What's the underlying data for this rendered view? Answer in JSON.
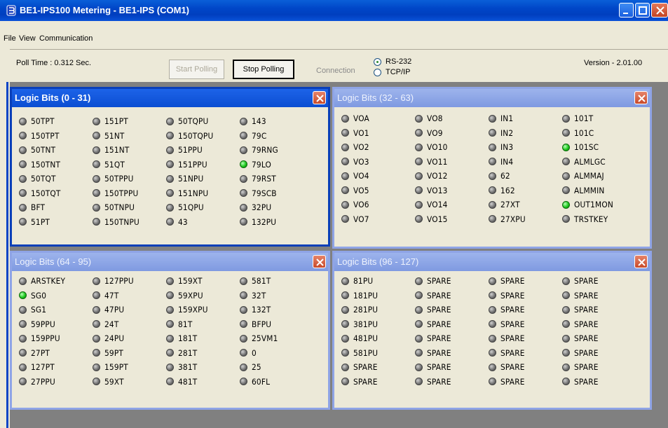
{
  "window": {
    "title": "BE1-IPS100 Metering - BE1-IPS (COM1)"
  },
  "menu": [
    {
      "label": "File"
    },
    {
      "label": "View"
    },
    {
      "label": "Communication"
    }
  ],
  "toolbar": {
    "poll_time": "Poll Time : 0.312 Sec.",
    "start_label": "Start Polling",
    "stop_label": "Stop Polling",
    "connection_label": "Connection",
    "radio_rs232": "RS-232",
    "radio_tcpip": "TCP/IP",
    "selected_connection": "RS-232",
    "version": "Version - 2.01.00"
  },
  "colors": {
    "led_on": "#1ec81e",
    "led_off": "#6e6e6e",
    "title_active": "#0b4ed2",
    "title_inactive": "#8fa4e6"
  },
  "panels": [
    {
      "title": "Logic Bits (0 - 31)",
      "active": true,
      "bits": [
        {
          "label": "50TPT",
          "on": false
        },
        {
          "label": "151PT",
          "on": false
        },
        {
          "label": "50TQPU",
          "on": false
        },
        {
          "label": "143",
          "on": false
        },
        {
          "label": "150TPT",
          "on": false
        },
        {
          "label": "51NT",
          "on": false
        },
        {
          "label": "150TQPU",
          "on": false
        },
        {
          "label": "79C",
          "on": false
        },
        {
          "label": "50TNT",
          "on": false
        },
        {
          "label": "151NT",
          "on": false
        },
        {
          "label": "51PPU",
          "on": false
        },
        {
          "label": "79RNG",
          "on": false
        },
        {
          "label": "150TNT",
          "on": false
        },
        {
          "label": "51QT",
          "on": false
        },
        {
          "label": "151PPU",
          "on": false
        },
        {
          "label": "79LO",
          "on": true
        },
        {
          "label": "50TQT",
          "on": false
        },
        {
          "label": "50TPPU",
          "on": false
        },
        {
          "label": "51NPU",
          "on": false
        },
        {
          "label": "79RST",
          "on": false
        },
        {
          "label": "150TQT",
          "on": false
        },
        {
          "label": "150TPPU",
          "on": false
        },
        {
          "label": "151NPU",
          "on": false
        },
        {
          "label": "79SCB",
          "on": false
        },
        {
          "label": "BFT",
          "on": false
        },
        {
          "label": "50TNPU",
          "on": false
        },
        {
          "label": "51QPU",
          "on": false
        },
        {
          "label": "32PU",
          "on": false
        },
        {
          "label": "51PT",
          "on": false
        },
        {
          "label": "150TNPU",
          "on": false
        },
        {
          "label": "43",
          "on": false
        },
        {
          "label": "132PU",
          "on": false
        }
      ]
    },
    {
      "title": "Logic Bits (32 - 63)",
      "active": false,
      "bits": [
        {
          "label": "VOA",
          "on": false
        },
        {
          "label": "VO8",
          "on": false
        },
        {
          "label": "IN1",
          "on": false
        },
        {
          "label": "101T",
          "on": false
        },
        {
          "label": "VO1",
          "on": false
        },
        {
          "label": "VO9",
          "on": false
        },
        {
          "label": "IN2",
          "on": false
        },
        {
          "label": "101C",
          "on": false
        },
        {
          "label": "VO2",
          "on": false
        },
        {
          "label": "VO10",
          "on": false
        },
        {
          "label": "IN3",
          "on": false
        },
        {
          "label": "101SC",
          "on": true
        },
        {
          "label": "VO3",
          "on": false
        },
        {
          "label": "VO11",
          "on": false
        },
        {
          "label": "IN4",
          "on": false
        },
        {
          "label": "ALMLGC",
          "on": false
        },
        {
          "label": "VO4",
          "on": false
        },
        {
          "label": "VO12",
          "on": false
        },
        {
          "label": "62",
          "on": false
        },
        {
          "label": "ALMMAJ",
          "on": false
        },
        {
          "label": "VO5",
          "on": false
        },
        {
          "label": "VO13",
          "on": false
        },
        {
          "label": "162",
          "on": false
        },
        {
          "label": "ALMMIN",
          "on": false
        },
        {
          "label": "VO6",
          "on": false
        },
        {
          "label": "VO14",
          "on": false
        },
        {
          "label": "27XT",
          "on": false
        },
        {
          "label": "OUT1MON",
          "on": true
        },
        {
          "label": "VO7",
          "on": false
        },
        {
          "label": "VO15",
          "on": false
        },
        {
          "label": "27XPU",
          "on": false
        },
        {
          "label": "TRSTKEY",
          "on": false
        }
      ]
    },
    {
      "title": "Logic Bits (64 - 95)",
      "active": false,
      "bits": [
        {
          "label": "ARSTKEY",
          "on": false
        },
        {
          "label": "127PPU",
          "on": false
        },
        {
          "label": "159XT",
          "on": false
        },
        {
          "label": "581T",
          "on": false
        },
        {
          "label": "SG0",
          "on": true
        },
        {
          "label": "47T",
          "on": false
        },
        {
          "label": "59XPU",
          "on": false
        },
        {
          "label": "32T",
          "on": false
        },
        {
          "label": "SG1",
          "on": false
        },
        {
          "label": "47PU",
          "on": false
        },
        {
          "label": "159XPU",
          "on": false
        },
        {
          "label": "132T",
          "on": false
        },
        {
          "label": "59PPU",
          "on": false
        },
        {
          "label": "24T",
          "on": false
        },
        {
          "label": "81T",
          "on": false
        },
        {
          "label": "BFPU",
          "on": false
        },
        {
          "label": "159PPU",
          "on": false
        },
        {
          "label": "24PU",
          "on": false
        },
        {
          "label": "181T",
          "on": false
        },
        {
          "label": "25VM1",
          "on": false
        },
        {
          "label": "27PT",
          "on": false
        },
        {
          "label": "59PT",
          "on": false
        },
        {
          "label": "281T",
          "on": false
        },
        {
          "label": "0",
          "on": false
        },
        {
          "label": "127PT",
          "on": false
        },
        {
          "label": "159PT",
          "on": false
        },
        {
          "label": "381T",
          "on": false
        },
        {
          "label": "25",
          "on": false
        },
        {
          "label": "27PPU",
          "on": false
        },
        {
          "label": "59XT",
          "on": false
        },
        {
          "label": "481T",
          "on": false
        },
        {
          "label": "60FL",
          "on": false
        }
      ]
    },
    {
      "title": "Logic Bits (96 - 127)",
      "active": false,
      "bits": [
        {
          "label": "81PU",
          "on": false
        },
        {
          "label": "SPARE",
          "on": false
        },
        {
          "label": "SPARE",
          "on": false
        },
        {
          "label": "SPARE",
          "on": false
        },
        {
          "label": "181PU",
          "on": false
        },
        {
          "label": "SPARE",
          "on": false
        },
        {
          "label": "SPARE",
          "on": false
        },
        {
          "label": "SPARE",
          "on": false
        },
        {
          "label": "281PU",
          "on": false
        },
        {
          "label": "SPARE",
          "on": false
        },
        {
          "label": "SPARE",
          "on": false
        },
        {
          "label": "SPARE",
          "on": false
        },
        {
          "label": "381PU",
          "on": false
        },
        {
          "label": "SPARE",
          "on": false
        },
        {
          "label": "SPARE",
          "on": false
        },
        {
          "label": "SPARE",
          "on": false
        },
        {
          "label": "481PU",
          "on": false
        },
        {
          "label": "SPARE",
          "on": false
        },
        {
          "label": "SPARE",
          "on": false
        },
        {
          "label": "SPARE",
          "on": false
        },
        {
          "label": "581PU",
          "on": false
        },
        {
          "label": "SPARE",
          "on": false
        },
        {
          "label": "SPARE",
          "on": false
        },
        {
          "label": "SPARE",
          "on": false
        },
        {
          "label": "SPARE",
          "on": false
        },
        {
          "label": "SPARE",
          "on": false
        },
        {
          "label": "SPARE",
          "on": false
        },
        {
          "label": "SPARE",
          "on": false
        },
        {
          "label": "SPARE",
          "on": false
        },
        {
          "label": "SPARE",
          "on": false
        },
        {
          "label": "SPARE",
          "on": false
        },
        {
          "label": "SPARE",
          "on": false
        }
      ]
    }
  ]
}
